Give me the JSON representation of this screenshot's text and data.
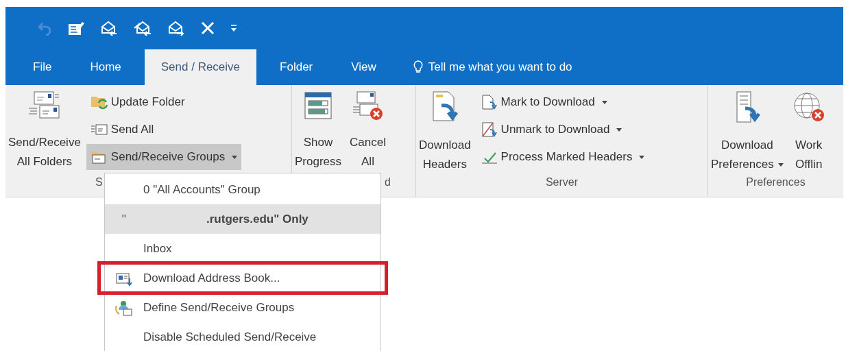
{
  "tabs": [
    {
      "label": "File",
      "selected": false
    },
    {
      "label": "Home",
      "selected": false
    },
    {
      "label": "Send / Receive",
      "selected": true
    },
    {
      "label": "Folder",
      "selected": false
    },
    {
      "label": "View",
      "selected": false
    }
  ],
  "tell_me": {
    "placeholder": "Tell me what you want to do"
  },
  "ribbon": {
    "groups": [
      {
        "label": "S",
        "controls": [
          {
            "kind": "large",
            "lines": [
              "Send/Receive",
              "All Folders"
            ],
            "dropdown": false
          },
          {
            "kind": "stack",
            "items": [
              {
                "label": "Update Folder",
                "dropdown": false,
                "pressed": false
              },
              {
                "label": "Send All",
                "dropdown": false,
                "pressed": false
              },
              {
                "label": "Send/Receive Groups",
                "dropdown": true,
                "pressed": true
              }
            ]
          }
        ]
      },
      {
        "label": "d",
        "controls": [
          {
            "kind": "large",
            "lines": [
              "Show",
              "Progress"
            ],
            "dropdown": false
          },
          {
            "kind": "large",
            "lines": [
              "Cancel",
              "All"
            ],
            "dropdown": false
          }
        ]
      },
      {
        "label": "Server",
        "controls": [
          {
            "kind": "large",
            "lines": [
              "Download",
              "Headers"
            ],
            "dropdown": false
          },
          {
            "kind": "stack",
            "items": [
              {
                "label": "Mark to Download",
                "dropdown": true,
                "pressed": false
              },
              {
                "label": "Unmark to Download",
                "dropdown": true,
                "pressed": false
              },
              {
                "label": "Process Marked Headers",
                "dropdown": true,
                "pressed": false
              }
            ]
          }
        ]
      },
      {
        "label": "Preferences",
        "controls": [
          {
            "kind": "large",
            "lines": [
              "Download",
              "Preferences"
            ],
            "dropdown": true
          },
          {
            "kind": "large",
            "lines": [
              "Work",
              "Offlin"
            ],
            "dropdown": false
          }
        ]
      }
    ]
  },
  "menu": {
    "items": [
      {
        "label": "0 \"All Accounts\" Group",
        "selected": false,
        "outlined": false,
        "bold": false
      },
      {
        "label_start": "\"",
        "label": ".rutgers.edu\" Only",
        "selected": true,
        "outlined": false,
        "bold": true
      },
      {
        "label": "Inbox",
        "selected": false,
        "outlined": false,
        "bold": false
      },
      {
        "label": "Download Address Book...",
        "selected": false,
        "outlined": true,
        "bold": false
      },
      {
        "label": "Define Send/Receive Groups",
        "selected": false,
        "outlined": false,
        "bold": false
      },
      {
        "label": "Disable Scheduled Send/Receive",
        "selected": false,
        "outlined": false,
        "bold": false
      }
    ]
  }
}
